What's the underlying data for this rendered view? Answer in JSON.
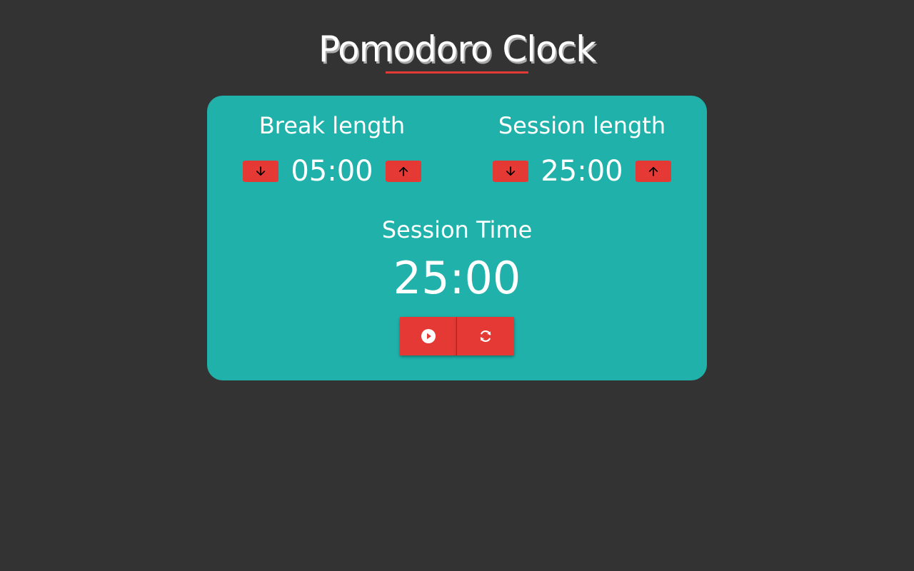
{
  "app": {
    "title": "Pomodoro Clock"
  },
  "break": {
    "label": "Break length",
    "value": "05:00",
    "decrement_icon": "arrow-down-icon",
    "increment_icon": "arrow-up-icon"
  },
  "session": {
    "label": "Session length",
    "value": "25:00",
    "decrement_icon": "arrow-down-icon",
    "increment_icon": "arrow-up-icon"
  },
  "timer": {
    "label": "Session Time",
    "time": "25:00"
  },
  "controls": {
    "play_icon": "play-circle-icon",
    "reset_icon": "refresh-icon"
  },
  "colors": {
    "background": "#333333",
    "card": "#20b2aa",
    "accent": "#e53935",
    "text": "#ffffff"
  }
}
